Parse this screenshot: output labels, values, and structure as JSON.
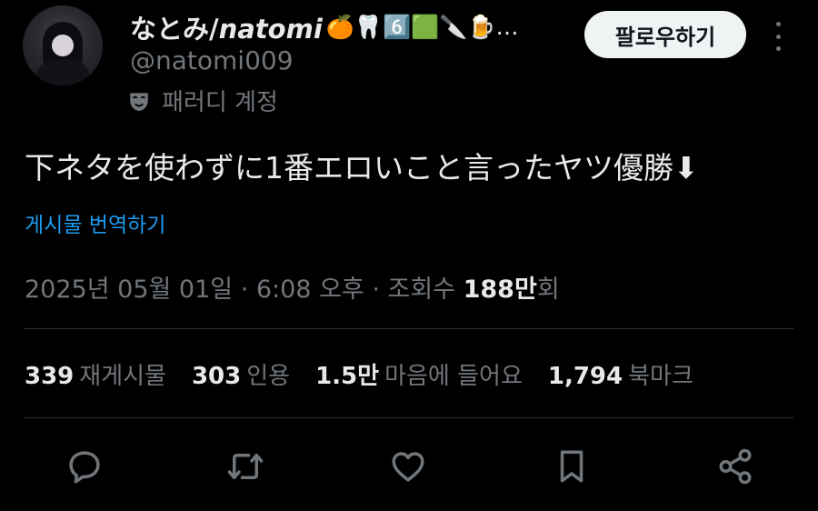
{
  "author": {
    "display_name_jp": "なとみ/",
    "display_name_latin": "natomi",
    "emojis": "🍊🦷6️⃣🟩🔪🍺…",
    "handle": "@natomi009",
    "parody_label": "패러디 계정"
  },
  "follow_button": {
    "label": "팔로우하기"
  },
  "tweet": {
    "text": "下ネタを使わずに1番エロいこと言ったヤツ優勝⬇",
    "translate_label": "게시물 번역하기",
    "meta_prefix": "2025년 05월 01일 · 6:08 오후 · 조회수 ",
    "views": "188만",
    "views_suffix": "회"
  },
  "stats": [
    {
      "num": "339",
      "label": "재게시물"
    },
    {
      "num": "303",
      "label": "인용"
    },
    {
      "num": "1.5만",
      "label": "마음에 들어요"
    },
    {
      "num": "1,794",
      "label": "북마크"
    }
  ],
  "actions": [
    "reply-icon",
    "retweet-icon",
    "like-icon",
    "bookmark-icon",
    "share-icon"
  ],
  "colors": {
    "background": "#000000",
    "text": "#e7e9ea",
    "muted": "#71767b",
    "link": "#1d9bf0",
    "divider": "#2f3336"
  }
}
